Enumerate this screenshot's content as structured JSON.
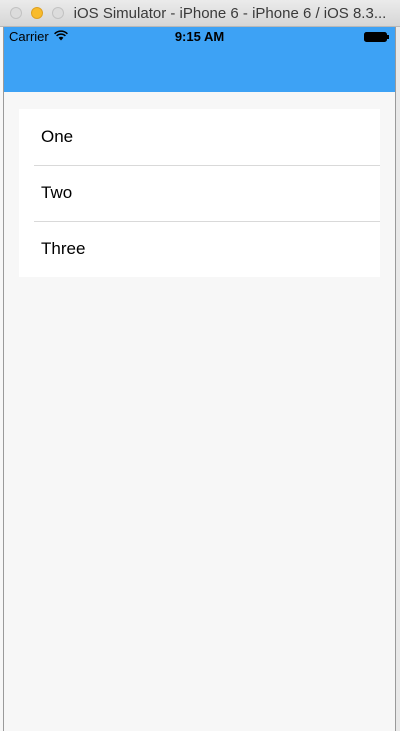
{
  "window": {
    "title": "iOS Simulator - iPhone 6 - iPhone 6 / iOS 8.3..."
  },
  "status_bar": {
    "carrier": "Carrier",
    "time": "9:15 AM"
  },
  "nav_bar": {
    "color": "#3da2f5"
  },
  "list": {
    "items": [
      {
        "label": "One"
      },
      {
        "label": "Two"
      },
      {
        "label": "Three"
      }
    ]
  },
  "icons": {
    "wifi": "wifi-icon",
    "battery": "battery-icon"
  }
}
